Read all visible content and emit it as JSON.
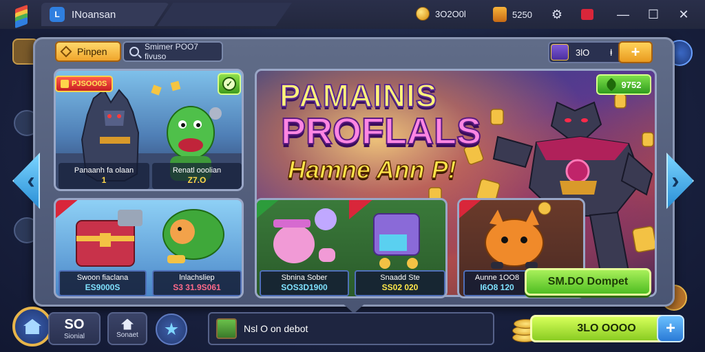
{
  "window": {
    "tab_icon_label": "L",
    "tab_title": "INoansan",
    "coins": "3O2O0l",
    "gems": "5250"
  },
  "toolbar": {
    "primary_button": "Pinpen",
    "search_text": "Smimer POO7 fivuso"
  },
  "currency": {
    "amount": "3lO",
    "symbol": "ⱡ",
    "plus": "+"
  },
  "top_left_card": {
    "badge": "PJSOO0S",
    "left_label": "Panaanh fa olaan",
    "left_value": "1",
    "right_label": "Renatl ooolian",
    "right_value": "Z7.O"
  },
  "hero": {
    "title_line1": "PAMAINIS",
    "title_line2": "PROFLALS",
    "subtitle": "Hamne Ann P!",
    "badge": "9752",
    "cta": "SM.DO Dompet"
  },
  "cards": [
    {
      "label": "Swoon fiaclana",
      "value": "ES9000S"
    },
    {
      "label": "lnlachsliep",
      "value": "S3 31.9S061"
    },
    {
      "label": "Sbnina Sober",
      "value": "SOS3D1900"
    },
    {
      "label": "Snaadd Ste",
      "value": "SS02 020"
    },
    {
      "label": "Aunne 1OO8",
      "value": "I6O8 120"
    }
  ],
  "bottom": {
    "tile1_big": "SO",
    "tile1_small": "Sionial",
    "tile2_small": "Sonaet",
    "chat_text": "Nsl O on debot",
    "buy_text": "3LO OOOO",
    "buy_plus": "+"
  }
}
